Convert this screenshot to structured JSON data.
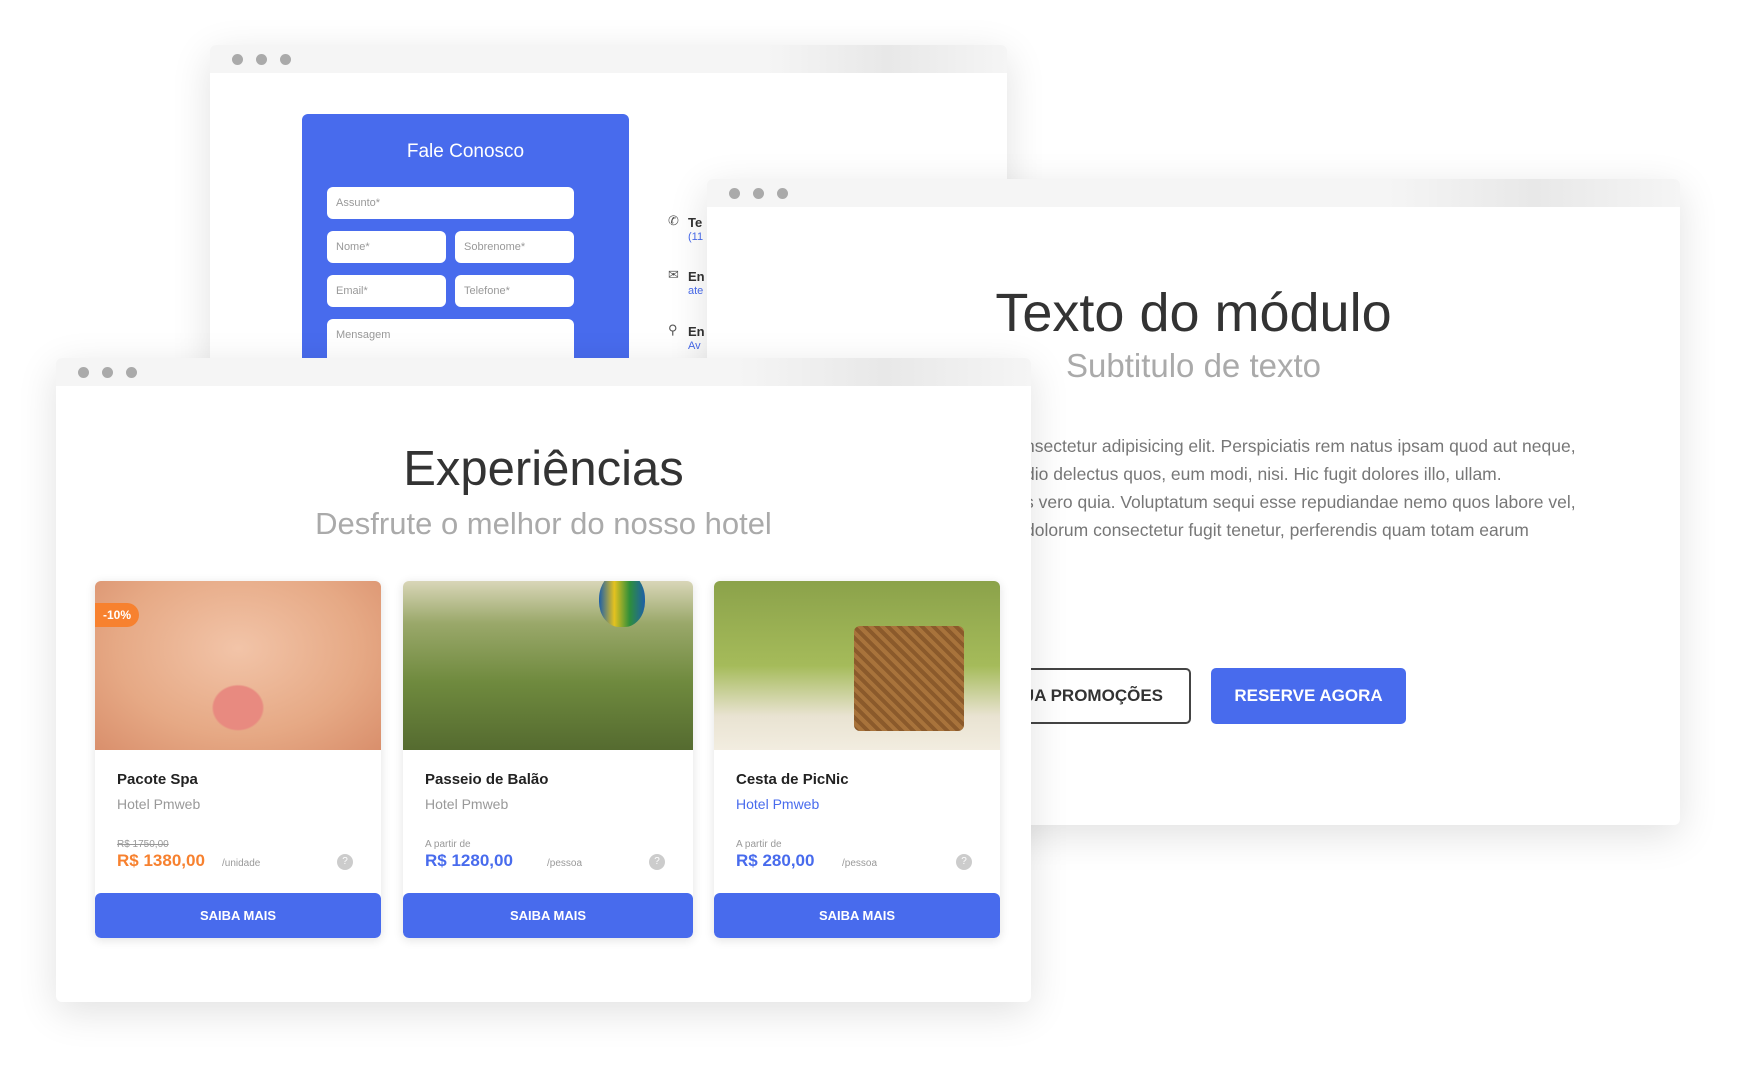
{
  "contact_window": {
    "title": "Fale Conosco",
    "fields": {
      "subject": "Assunto*",
      "first_name": "Nome*",
      "last_name": "Sobrenome*",
      "email": "Email*",
      "phone": "Telefone*",
      "message": "Mensagem"
    },
    "info": [
      {
        "icon": "phone-icon",
        "label": "Te",
        "value": "(11"
      },
      {
        "icon": "envelope-icon",
        "label": "En",
        "value": "ate"
      },
      {
        "icon": "map-pin-icon",
        "label": "En",
        "value": "Av"
      }
    ]
  },
  "module_window": {
    "title": "Texto do módulo",
    "subtitle": "Subtitulo de texto",
    "paragraph1": [
      "nsectetur adipisicing elit. Perspiciatis rem natus ipsam quod aut neque,",
      "dio delectus quos, eum modi, nisi. Hic fugit dolores illo, ullam."
    ],
    "paragraph2": [
      "s vero quia. Voluptatum sequi esse repudiandae nemo quos labore vel,",
      "dolorum consectetur fugit tenetur, perferendis quam totam earum"
    ],
    "promo_button": "JA PROMOÇÕES",
    "reserve_button": "RESERVE AGORA"
  },
  "experiences_window": {
    "title": "Experiências",
    "subtitle": "Desfrute o melhor do nosso hotel",
    "cards": [
      {
        "title": "Pacote Spa",
        "hotel": "Hotel Pmweb",
        "badge": "-10%",
        "old_price": "R$ 1750,00",
        "price": "R$ 1380,00",
        "unit": "/unidade",
        "button": "SAIBA MAIS"
      },
      {
        "title": "Passeio de Balão",
        "hotel": "Hotel Pmweb",
        "prefix": "A partir de",
        "price": "R$ 1280,00",
        "unit": "/pessoa",
        "button": "SAIBA MAIS"
      },
      {
        "title": "Cesta de PicNic",
        "hotel": "Hotel Pmweb",
        "prefix": "A partir de",
        "price": "R$ 280,00",
        "unit": "/pessoa",
        "button": "SAIBA MAIS"
      }
    ]
  },
  "colors": {
    "accent": "#486bed",
    "discount": "#f7812f"
  }
}
